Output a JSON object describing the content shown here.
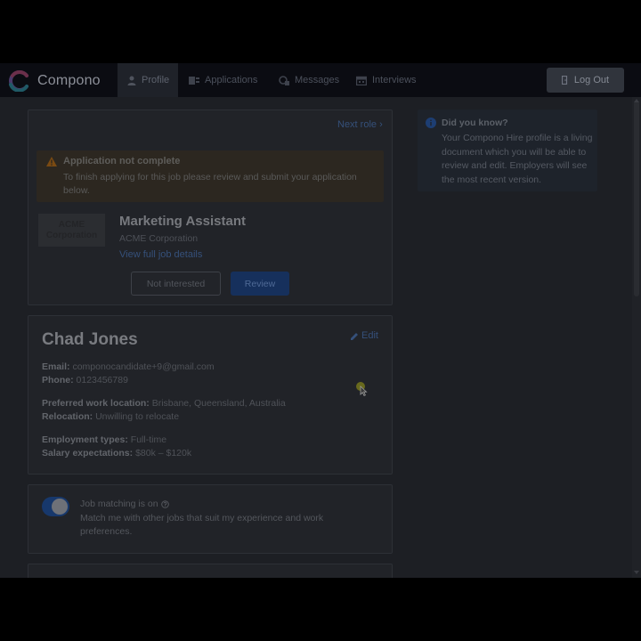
{
  "app": {
    "brand": "Compono",
    "colors": {
      "accent": "#16305c",
      "navbar": "#0b0c12",
      "warning": "#e89b2c",
      "info": "#2f6fd1"
    }
  },
  "nav": {
    "items": [
      {
        "label": "Profile",
        "icon": "person-icon",
        "active": true
      },
      {
        "label": "Applications",
        "icon": "applications-icon",
        "active": false
      },
      {
        "label": "Messages",
        "icon": "messages-icon",
        "active": false
      },
      {
        "label": "Interviews",
        "icon": "calendar-icon",
        "active": false
      }
    ],
    "logout_label": "Log Out"
  },
  "application_card": {
    "next_role_label": "Next role ›",
    "alert": {
      "title": "Application not complete",
      "text": "To finish applying for this job please review and submit your application below."
    },
    "company_logo_line1": "ACME",
    "company_logo_line2": "Corporation",
    "job_title": "Marketing Assistant",
    "company": "ACME Corporation",
    "view_details_label": "View full job details",
    "not_interested_label": "Not interested",
    "review_label": "Review"
  },
  "profile_card": {
    "name": "Chad Jones",
    "edit_label": "Edit",
    "email_label": "Email:",
    "email": "componocandidate+9@gmail.com",
    "phone_label": "Phone:",
    "phone": "0123456789",
    "location_label": "Preferred work location:",
    "location": "Brisbane, Queensland, Australia",
    "relocation_label": "Relocation:",
    "relocation": "Unwilling to relocate",
    "employment_label": "Employment types:",
    "employment": "Full-time",
    "salary_label": "Salary expectations:",
    "salary": "$80k – $120k"
  },
  "matching_card": {
    "enabled": true,
    "title": "Job matching is on",
    "text": "Match me with other jobs that suit my experience and work preferences."
  },
  "did_you_know": {
    "title": "Did you know?",
    "text": "Your Compono Hire profile is a living document which you will be able to review and edit. Employers will see the most recent version."
  }
}
